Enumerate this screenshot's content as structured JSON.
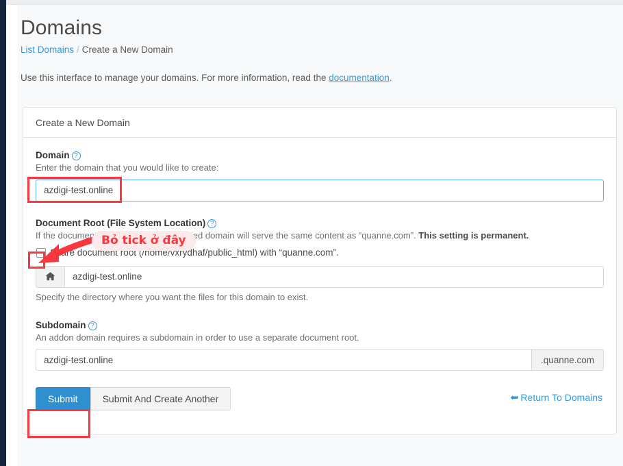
{
  "page": {
    "title": "Domains",
    "breadcrumb": {
      "link_label": "List Domains",
      "separator": "/",
      "current": "Create a New Domain"
    },
    "intro": {
      "text_before": "Use this interface to manage your domains. For more information, read the ",
      "link_label": "documentation",
      "text_after": "."
    }
  },
  "panel": {
    "heading": "Create a New Domain"
  },
  "fields": {
    "domain": {
      "label": "Domain",
      "help_icon": "help-circle-icon",
      "help_glyph": "?",
      "description": "Enter the domain that you would like to create:",
      "value": "azdigi-test.online",
      "placeholder": ""
    },
    "document_root": {
      "label": "Document Root (File System Location)",
      "help_icon": "help-circle-icon",
      "help_glyph": "?",
      "description_plain": "If the document root is shared, the created domain will serve the same content as “quanne.com”. ",
      "description_bold": "This setting is permanent.",
      "checkbox_label": "Share document root (/home/vxrydhaf/public_html) with “quanne.com”.",
      "checkbox_checked": false,
      "addon_icon": "home-icon",
      "value": "azdigi-test.online",
      "hint": "Specify the directory where you want the files for this domain to exist."
    },
    "subdomain": {
      "label": "Subdomain",
      "help_icon": "help-circle-icon",
      "help_glyph": "?",
      "description": "An addon domain requires a subdomain in order to use a separate document root.",
      "value": "azdigi-test.online",
      "suffix": ".quanne.com"
    }
  },
  "actions": {
    "submit_label": "Submit",
    "submit_another_label": "Submit And Create Another",
    "return_label": "Return To Domains",
    "return_icon": "back-arrow-icon"
  },
  "annotations": {
    "untick_label": "Bỏ tick ở đây",
    "highlight_color": "#f8373f",
    "label_background": "#fde8ea"
  },
  "theme": {
    "accent_blue": "#3498db",
    "primary_button": "#2f90cf",
    "rail_dark": "#14243d",
    "page_background": "#f8f9fa"
  }
}
